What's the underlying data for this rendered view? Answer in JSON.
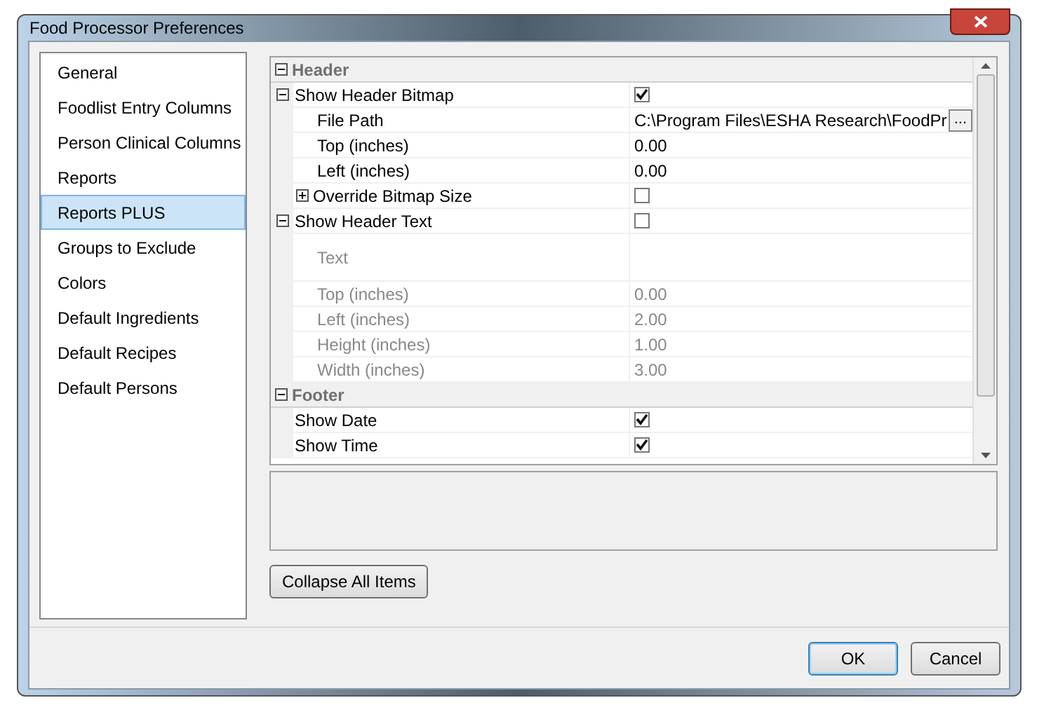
{
  "window": {
    "title": "Food Processor Preferences"
  },
  "sidebar": {
    "items": [
      {
        "label": "General",
        "selected": false
      },
      {
        "label": "Foodlist Entry Columns",
        "selected": false
      },
      {
        "label": "Person Clinical Columns",
        "selected": false
      },
      {
        "label": "Reports",
        "selected": false
      },
      {
        "label": "Reports PLUS",
        "selected": true
      },
      {
        "label": "Groups to Exclude",
        "selected": false
      },
      {
        "label": "Colors",
        "selected": false
      },
      {
        "label": "Default Ingredients",
        "selected": false
      },
      {
        "label": "Default Recipes",
        "selected": false
      },
      {
        "label": "Default Persons",
        "selected": false
      }
    ]
  },
  "property_grid": {
    "sections": [
      {
        "title": "Header",
        "expanded": true,
        "properties": [
          {
            "label": "Show Header Bitmap",
            "kind": "checkbox",
            "checked": true,
            "disabled": false,
            "expanded": true,
            "children": [
              {
                "label": "File Path",
                "kind": "path",
                "value": "C:\\Program Files\\ESHA Research\\FoodPr",
                "browse": "...",
                "disabled": false
              },
              {
                "label": "Top (inches)",
                "kind": "text",
                "value": "0.00",
                "disabled": false
              },
              {
                "label": "Left (inches)",
                "kind": "text",
                "value": "0.00",
                "disabled": false
              },
              {
                "label": "Override Bitmap Size",
                "kind": "checkbox",
                "checked": false,
                "disabled": false,
                "expanded": false
              }
            ]
          },
          {
            "label": "Show Header Text",
            "kind": "checkbox",
            "checked": false,
            "disabled": false,
            "expanded": true,
            "children": [
              {
                "label": "Text",
                "kind": "multiline",
                "disabled": true
              },
              {
                "label": "Top (inches)",
                "kind": "text",
                "value": "0.00",
                "disabled": true
              },
              {
                "label": "Left (inches)",
                "kind": "text",
                "value": "2.00",
                "disabled": true
              },
              {
                "label": "Height (inches)",
                "kind": "text",
                "value": "1.00",
                "disabled": true
              },
              {
                "label": "Width (inches)",
                "kind": "text",
                "value": "3.00",
                "disabled": true
              }
            ]
          }
        ]
      },
      {
        "title": "Footer",
        "expanded": true,
        "properties": [
          {
            "label": "Show Date",
            "kind": "checkbox",
            "checked": true,
            "disabled": false
          },
          {
            "label": "Show Time",
            "kind": "checkbox",
            "checked": true,
            "disabled": false
          }
        ]
      }
    ]
  },
  "collapse_button": "Collapse All Items",
  "buttons": [
    {
      "label": "OK",
      "default": true
    },
    {
      "label": "Cancel",
      "default": false
    }
  ]
}
